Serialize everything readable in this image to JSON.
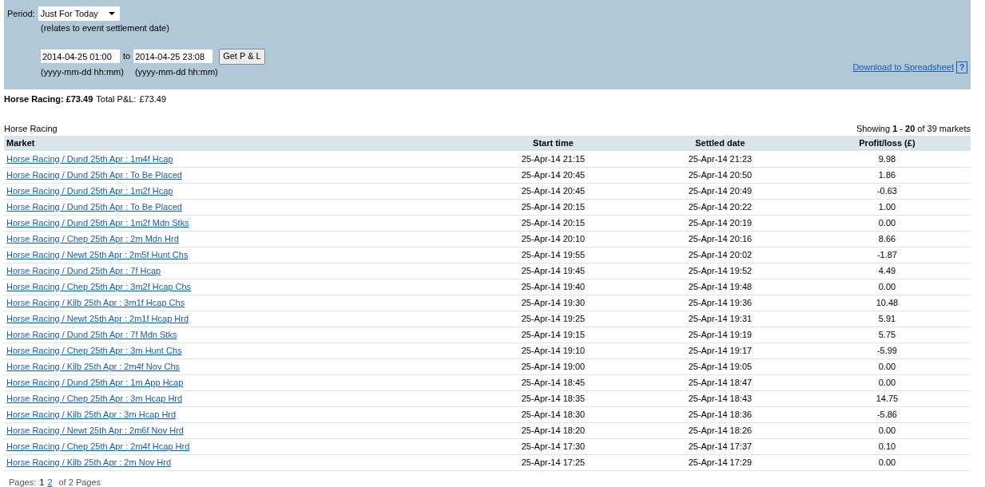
{
  "filter": {
    "period_label": "Period:",
    "period_value": "Just For Today",
    "period_note": "(relates to event settlement date)",
    "from_value": "2014-04-25 01:00",
    "to_label": "to",
    "to_value": "2014-04-25 23:08",
    "from_hint": "(yyyy-mm-dd hh:mm)",
    "to_hint": "(yyyy-mm-dd hh:mm)",
    "button": "Get P & L",
    "download_link": "Download to Spreadsheet",
    "help": "?"
  },
  "summary": {
    "category_total": "Horse Racing: £73.49",
    "total_label": "Total P&L:",
    "total_value": "£73.49"
  },
  "table": {
    "title": "Horse Racing",
    "showing": "Showing **1** - **20** of 39 markets",
    "columns": [
      "Market",
      "Start time",
      "Settled date",
      "Profit/loss (£)"
    ],
    "rows": [
      [
        "Horse Racing / Dund 25th Apr : 1m4f Hcap",
        "25-Apr-14 21:15",
        "25-Apr-14 21:23",
        "9.98"
      ],
      [
        "Horse Racing / Dund 25th Apr : To Be Placed",
        "25-Apr-14 20:45",
        "25-Apr-14 20:50",
        "1.86"
      ],
      [
        "Horse Racing / Dund 25th Apr : 1m2f Hcap",
        "25-Apr-14 20:45",
        "25-Apr-14 20:49",
        "-0.63"
      ],
      [
        "Horse Racing / Dund 25th Apr : To Be Placed",
        "25-Apr-14 20:15",
        "25-Apr-14 20:22",
        "1.00"
      ],
      [
        "Horse Racing / Dund 25th Apr : 1m2f Mdn Stks",
        "25-Apr-14 20:15",
        "25-Apr-14 20:19",
        "0.00"
      ],
      [
        "Horse Racing / Chep 25th Apr : 2m Mdn Hrd",
        "25-Apr-14 20:10",
        "25-Apr-14 20:16",
        "8.66"
      ],
      [
        "Horse Racing / Newt 25th Apr : 2m5f Hunt Chs",
        "25-Apr-14 19:55",
        "25-Apr-14 20:02",
        "-1.87"
      ],
      [
        "Horse Racing / Dund 25th Apr : 7f Hcap",
        "25-Apr-14 19:45",
        "25-Apr-14 19:52",
        "4.49"
      ],
      [
        "Horse Racing / Chep 25th Apr : 3m2f Hcap Chs",
        "25-Apr-14 19:40",
        "25-Apr-14 19:48",
        "0.00"
      ],
      [
        "Horse Racing / Kilb 25th Apr : 3m1f Hcap Chs",
        "25-Apr-14 19:30",
        "25-Apr-14 19:36",
        "10.48"
      ],
      [
        "Horse Racing / Newt 25th Apr : 2m1f Hcap Hrd",
        "25-Apr-14 19:25",
        "25-Apr-14 19:31",
        "5.91"
      ],
      [
        "Horse Racing / Dund 25th Apr : 7f Mdn Stks",
        "25-Apr-14 19:15",
        "25-Apr-14 19:19",
        "5.75"
      ],
      [
        "Horse Racing / Chep 25th Apr : 3m Hunt Chs",
        "25-Apr-14 19:10",
        "25-Apr-14 19:17",
        "-5.99"
      ],
      [
        "Horse Racing / Kilb 25th Apr : 2m4f Nov Chs",
        "25-Apr-14 19:00",
        "25-Apr-14 19:05",
        "0.00"
      ],
      [
        "Horse Racing / Dund 25th Apr : 1m App Hcap",
        "25-Apr-14 18:45",
        "25-Apr-14 18:47",
        "0.00"
      ],
      [
        "Horse Racing / Chep 25th Apr : 3m Hcap Hrd",
        "25-Apr-14 18:35",
        "25-Apr-14 18:43",
        "14.75"
      ],
      [
        "Horse Racing / Kilb 25th Apr : 3m Hcap Hrd",
        "25-Apr-14 18:30",
        "25-Apr-14 18:36",
        "-5.86"
      ],
      [
        "Horse Racing / Newt 25th Apr : 2m6f Nov Hrd",
        "25-Apr-14 18:20",
        "25-Apr-14 18:26",
        "0.00"
      ],
      [
        "Horse Racing / Chep 25th Apr : 2m4f Hcap Hrd",
        "25-Apr-14 17:30",
        "25-Apr-14 17:37",
        "0.10"
      ],
      [
        "Horse Racing / Kilb 25th Apr : 2m Nov Hrd",
        "25-Apr-14 17:25",
        "25-Apr-14 17:29",
        "0.00"
      ]
    ]
  },
  "pagination": {
    "label": "Pages:",
    "pages": [
      {
        "label": "1",
        "selected": true
      },
      {
        "label": "2",
        "selected": false
      }
    ],
    "total": "of 2 Pages"
  }
}
